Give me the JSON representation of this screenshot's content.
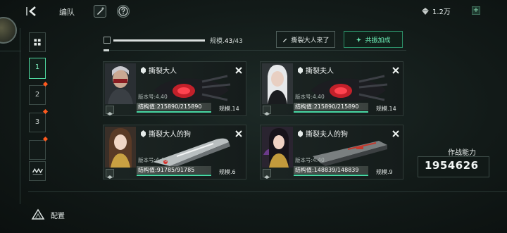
{
  "header": {
    "title": "编队",
    "currency_value": "1.2万"
  },
  "sidebar": {
    "tabs": [
      {
        "label": "1",
        "active": true,
        "alert": false
      },
      {
        "label": "2",
        "active": false,
        "alert": true
      },
      {
        "label": "3",
        "active": false,
        "alert": true
      },
      {
        "label": "",
        "active": false,
        "alert": true
      }
    ]
  },
  "fleet": {
    "scale_label": "规模.",
    "scale_current": "43",
    "scale_max": "/43",
    "scale_fraction": 1.0,
    "preset_button": "撕裂大人来了",
    "resonance_button": "共振加成"
  },
  "ships": [
    {
      "name": "撕裂大人",
      "version": "版本号:4.40",
      "hp": "结构值:215890/215890",
      "scale": "规模.14",
      "hp_fraction": 1.0,
      "ship_color": "#c3202a"
    },
    {
      "name": "撕裂夫人",
      "version": "版本号:4.40",
      "hp": "结构值:215890/215890",
      "scale": "规模.14",
      "hp_fraction": 1.0,
      "ship_color": "#c3202a"
    },
    {
      "name": "撕裂大人的狗",
      "version": "版本号:4.40",
      "hp": "结构值:91785/91785",
      "scale": "规模.6",
      "hp_fraction": 1.0,
      "ship_color": "#b9bfc0"
    },
    {
      "name": "撕裂夫人的狗",
      "version": "版本号:4.40",
      "hp": "结构值:148839/148839",
      "scale": "规模.9",
      "hp_fraction": 1.0,
      "ship_color": "#7a7f80"
    }
  ],
  "power": {
    "label": "作战能力",
    "value": "1954626"
  },
  "footer": {
    "config_label": "配置"
  },
  "colors": {
    "accent": "#49d8a4",
    "alert": "#ff5a1e"
  }
}
